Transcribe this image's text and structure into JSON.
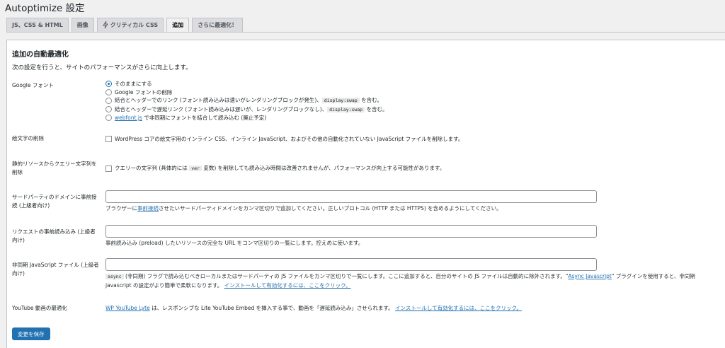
{
  "title": "Autoptimize 設定",
  "tabs": [
    {
      "label": "JS、CSS & HTML",
      "icon": ""
    },
    {
      "label": "画像",
      "icon": ""
    },
    {
      "label": "クリティカル CSS",
      "icon": "lightning-icon"
    },
    {
      "label": "追加",
      "icon": ""
    },
    {
      "label": "さらに最適化！",
      "icon": ""
    }
  ],
  "active_tab": "追加",
  "section": {
    "heading": "追加の自動最適化",
    "description": "次の設定を行うと、サイトのパフォーマンスがさらに向上します。"
  },
  "google_fonts": {
    "label": "Google フォント",
    "options": [
      {
        "text": "そのままにする",
        "checked": true
      },
      {
        "text": "Google フォントの削除",
        "checked": false
      },
      {
        "text": "結合とヘッダーでのリンク (フォント読み込みは速いがレンダリングブロックが発生)、",
        "code": "display:swap",
        "suffix": " を含む。",
        "checked": false
      },
      {
        "text": "結合とヘッダーで遅延リンク (フォント読み込みは遅いが、レンダリングブロックなし)、",
        "code": "display:swap",
        "suffix": " を含む。",
        "checked": false
      },
      {
        "link": "webfont.js",
        "text": " で非同期にフォントを結合して読み込む (廃止予定)",
        "checked": false
      }
    ]
  },
  "emoji": {
    "label": "絵文字の削除",
    "text": "WordPress コアの絵文字用のインライン CSS、インライン JavaScript、およびその他の自動化されていない JavaScript ファイルを削除します。"
  },
  "query_strings": {
    "label": "静的リソースからクエリー文字列を削除",
    "text_before": "クエリーの文字列 (具体的には ",
    "code": "ver",
    "text_after": " 変数) を削除しても読み込み時間は改善されませんが、パフォーマンスが向上する可能性があります。"
  },
  "preconnect": {
    "label": "サードパーティのドメインに事前接続 (上級者向け)",
    "value": "",
    "help_before": "ブラウザーに",
    "help_link": "事前接続",
    "help_after": "させたいサードパーティドメインをカンマ区切りで追加してください。正しいプロトコル (HTTP または HTTPS) を含めるようにしてください。"
  },
  "preload": {
    "label": "リクエストの事前読み込み (上級者向け)",
    "value": "",
    "help": "事前読み込み (preload) したいリソースの完全な URL をコンマ区切りの一覧にします。控えめに使います。"
  },
  "async_js": {
    "label": "非同期 JavaScript ファイル (上級者向け)",
    "value": "",
    "help_code": "async",
    "help_text": " (非同期) フラグで読み込むべきローカルまたはサードパーティの JS ファイルをカンマ区切りで一覧にします。ここに追加すると、自分のサイトの JS ファイルは自動的に除外されます。\"",
    "help_link": "Async Javascript",
    "help_text2": "\" プラグインを使用すると、非同期 javascript の設定がより簡単で柔軟になります。",
    "install_link": "インストールして有効化するには、ここをクリック。"
  },
  "youtube": {
    "label": "YouTube 動画の最適化",
    "link": "WP YouTube Lyte",
    "text": " は、レスポンシブな Lite YouTube Embed を挿入する事で、動画を「遅延読み込み」させられます。",
    "install_link": "インストールして有効化するには、ここをクリック。"
  },
  "save_button": "変更を保存",
  "colors": {
    "accent": "#2271b1",
    "background": "#f0f0f1"
  }
}
